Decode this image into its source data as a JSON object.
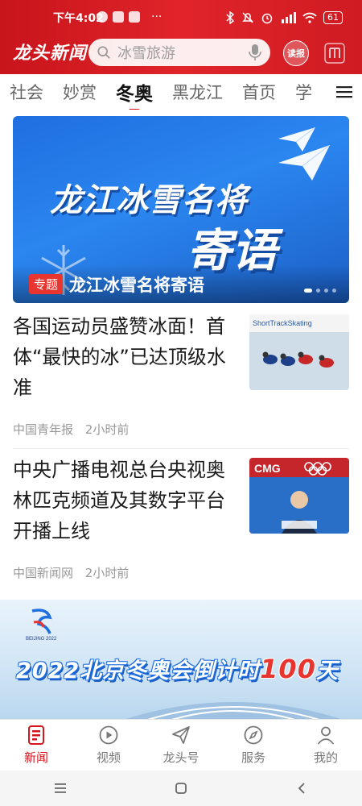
{
  "status_bar": {
    "time": "下午4:02",
    "more": "···",
    "battery": "61"
  },
  "app": {
    "logo_text": "龙头新闻",
    "read_label": "读报"
  },
  "search": {
    "placeholder": "冰雪旅游"
  },
  "tabs": [
    {
      "label": "社会",
      "active": false
    },
    {
      "label": "妙赏",
      "active": false
    },
    {
      "label": "冬奥",
      "active": true
    },
    {
      "label": "黑龙江",
      "active": false
    },
    {
      "label": "首页",
      "active": false
    },
    {
      "label": "学",
      "active": false
    }
  ],
  "banner": {
    "title_line1": "龙江冰雪名将",
    "title_line2": "寄语",
    "tag": "专题",
    "caption": "龙江冰雪名将寄语"
  },
  "articles": [
    {
      "title": "各国运动员盛赞冰面！首体“最快的冰”已达顶级水准",
      "source": "中国青年报",
      "time": "2小时前",
      "thumb_text": "ShortTrackSkating"
    },
    {
      "title": "中央广播电视总台央视奥林匹克频道及其数字平台开播上线",
      "source": "中国新闻网",
      "time": "2小时前",
      "thumb_text": "CMG"
    }
  ],
  "ad": {
    "lead": "2022北京冬奥会倒计时",
    "number": "100",
    "unit": "天",
    "logo_caption": "BEIJING 2022"
  },
  "bottom_nav": [
    {
      "label": "新闻",
      "active": true,
      "icon": "news-icon"
    },
    {
      "label": "视频",
      "active": false,
      "icon": "video-icon"
    },
    {
      "label": "龙头号",
      "active": false,
      "icon": "send-icon"
    },
    {
      "label": "服务",
      "active": false,
      "icon": "compass-icon"
    },
    {
      "label": "我的",
      "active": false,
      "icon": "user-icon"
    }
  ],
  "colors": {
    "brand_red": "#d5141b",
    "banner_blue": "#2b86f0"
  }
}
